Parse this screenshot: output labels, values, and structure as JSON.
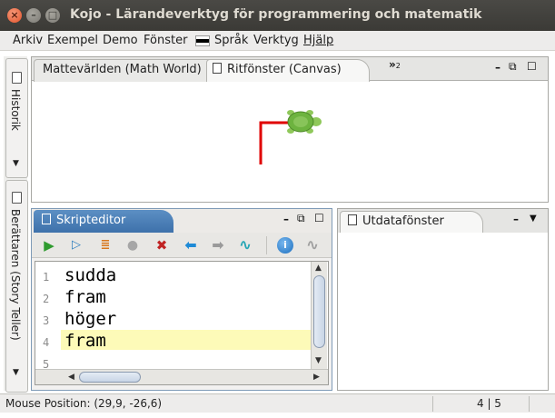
{
  "window": {
    "title": "Kojo - Lärandeverktyg för programmering och matematik"
  },
  "menu": [
    "Arkiv",
    "Exempel",
    "Demo",
    "Fönster",
    "Språk",
    "Verktyg",
    "Hjälp"
  ],
  "sidebar": {
    "history_label": "Historik",
    "story_label": "Berättaren (Story Teller)"
  },
  "canvas_panel": {
    "tabs": [
      "Mattevärlden (Math World)",
      "Ritfönster (Canvas)"
    ],
    "overflow_label": "»",
    "overflow_count": "2"
  },
  "editor": {
    "tab_label": "Skripteditor",
    "line_numbers": [
      "1",
      "2",
      "3",
      "4",
      "5"
    ],
    "lines": [
      "sudda",
      "fram",
      "höger",
      "fram",
      ""
    ],
    "highlighted_line": 4
  },
  "output_panel": {
    "tab_label": "Utdatafönster"
  },
  "status": {
    "mouse_position": "Mouse Position: (29,9, -26,6)",
    "cursor": "4 | 5"
  },
  "colors": {
    "titlebar": "#3c3b37",
    "editor_tab": "#4a7db5",
    "turtle_line": "#e00000",
    "turtle": "#6db33f",
    "highlight": "#fdfab8"
  }
}
